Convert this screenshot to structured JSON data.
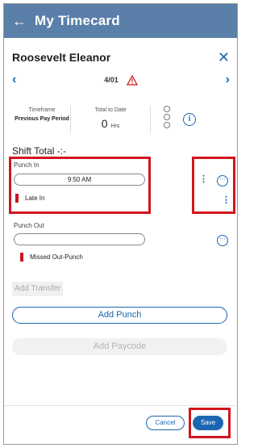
{
  "header": {
    "title": "My Timecard",
    "back_icon": "arrow-left-icon",
    "color": "#5a7fa8"
  },
  "employee": {
    "name": "Roosevelt Eleanor",
    "close_icon": "close-icon"
  },
  "nav": {
    "date": "4/01",
    "prev_icon": "chevron-left-icon",
    "next_icon": "chevron-right-icon",
    "warning_icon": "warning-triangle-icon"
  },
  "summary": {
    "timeframe_label": "Timeframe",
    "timeframe_value": "Previous Pay Period",
    "total_label": "Total to Date",
    "total_value": "0",
    "total_unit": "Hrs"
  },
  "shift_total": "Shift Total -:-",
  "punch_in": {
    "label": "Punch In",
    "value": "9:50 AM",
    "flag": "Late In"
  },
  "punch_out": {
    "label": "Punch Out",
    "value": "",
    "flag": "Missed Out-Punch"
  },
  "buttons": {
    "add_transfer": "Add Transfer",
    "add_punch": "Add Punch",
    "add_paycode": "Add Paycode",
    "cancel": "Cancel",
    "save": "Save"
  },
  "colors": {
    "accent": "#1b66b1",
    "highlight": "#d3151c",
    "flag": "#c8151b"
  }
}
